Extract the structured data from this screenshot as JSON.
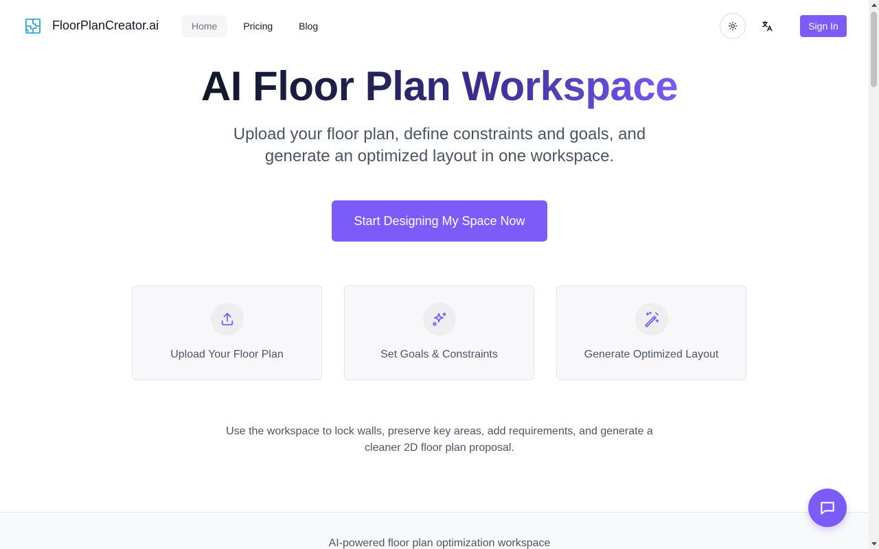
{
  "header": {
    "brand": "FloorPlanCreator.ai",
    "nav": [
      {
        "label": "Home",
        "active": true
      },
      {
        "label": "Pricing",
        "active": false
      },
      {
        "label": "Blog",
        "active": false
      }
    ],
    "theme_icon": "sun-icon",
    "lang_icon": "translate-icon",
    "signin_label": "Sign In"
  },
  "hero": {
    "title": "AI Floor Plan Workspace",
    "subtitle": "Upload your floor plan, define constraints and goals, and generate an optimized layout in one workspace.",
    "cta_label": "Start Designing My Space Now"
  },
  "features": [
    {
      "icon": "upload-icon",
      "label": "Upload Your Floor Plan"
    },
    {
      "icon": "sparkles-icon",
      "label": "Set Goals & Constraints"
    },
    {
      "icon": "magic-wand-icon",
      "label": "Generate Optimized Layout"
    }
  ],
  "description": "Use the workspace to lock walls, preserve key areas, add requirements, and generate a cleaner 2D floor plan proposal.",
  "footer": {
    "tagline": "AI-powered floor plan optimization workspace"
  },
  "chat_icon": "chat-bubble-icon",
  "colors": {
    "accent": "#7c5cf8",
    "logo": "#2aa8d8",
    "text_muted": "#4b5563"
  }
}
